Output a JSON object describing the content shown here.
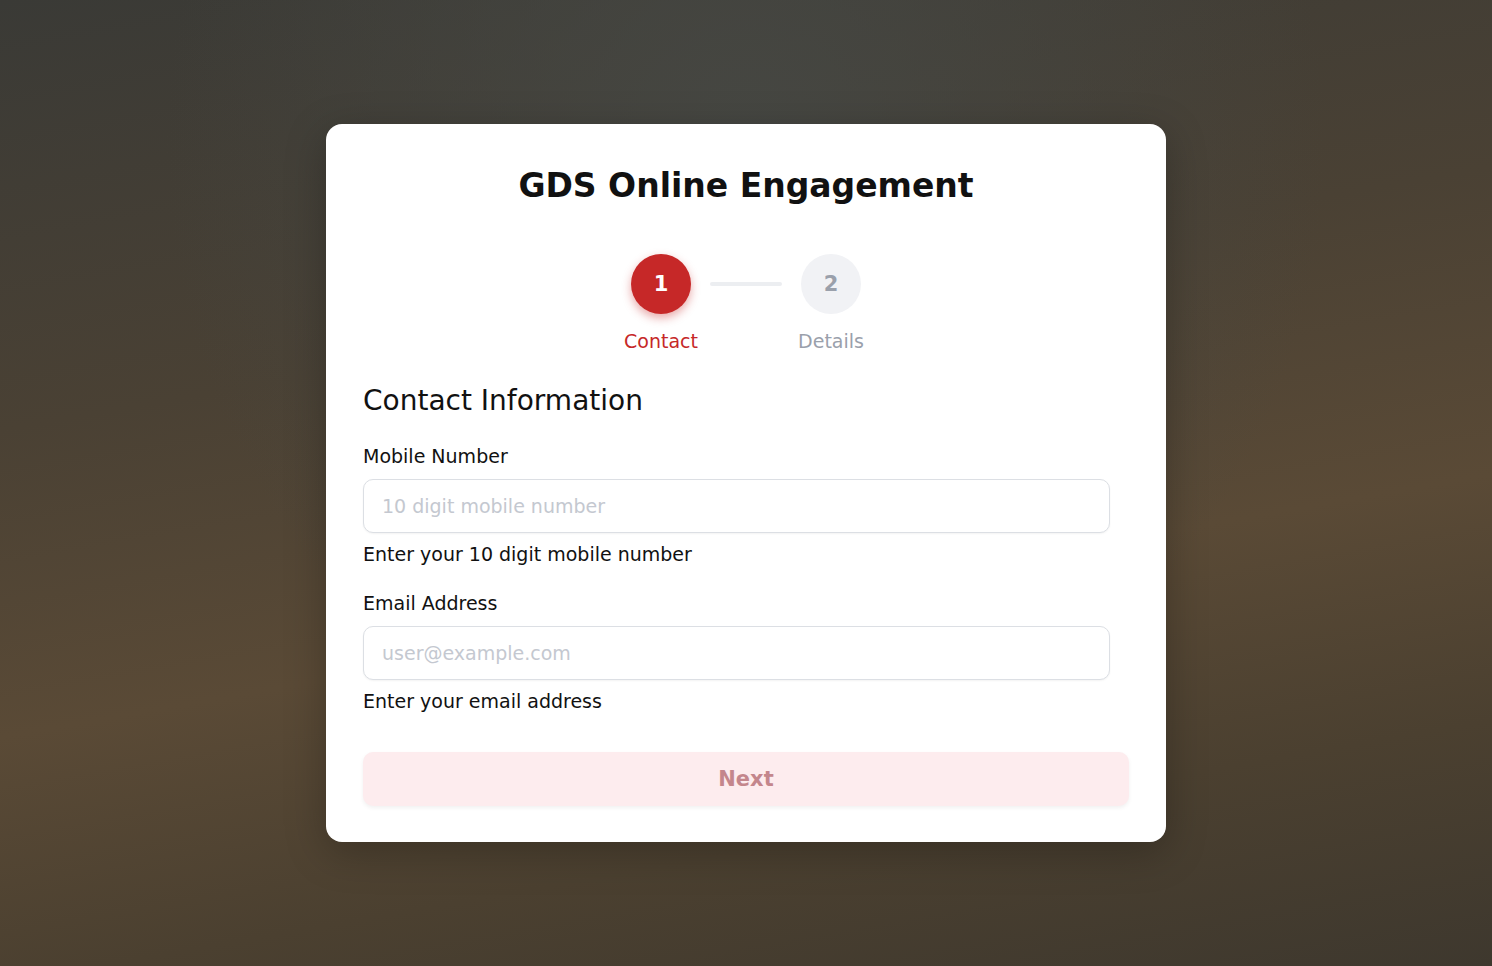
{
  "app": {
    "title": "GDS Online Engagement"
  },
  "steps": [
    {
      "number": "1",
      "label": "Contact",
      "selected": true
    },
    {
      "number": "2",
      "label": "Details",
      "selected": false
    }
  ],
  "section": {
    "title": "Contact Information"
  },
  "fields": [
    {
      "label": "Mobile Number",
      "placeholder": "10 digit mobile number",
      "value": "",
      "help": "Enter your 10 digit mobile number"
    },
    {
      "label": "Email Address",
      "placeholder": "user@example.com",
      "value": "",
      "help": "Enter your email address"
    }
  ],
  "button": {
    "label": "Next",
    "disabled": true
  }
}
